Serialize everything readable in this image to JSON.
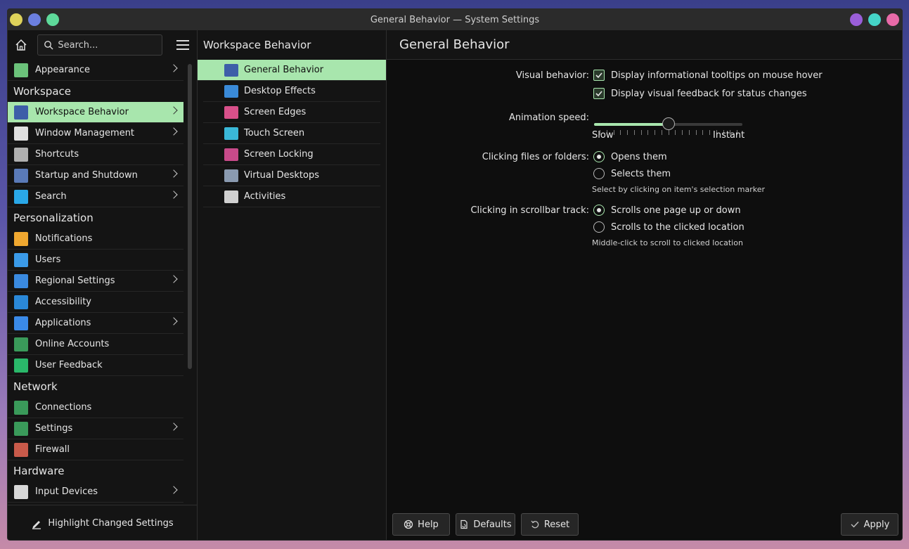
{
  "window": {
    "title": "General Behavior — System Settings"
  },
  "sidebar": {
    "search_placeholder": "Search...",
    "items": [
      {
        "type": "item",
        "label": "Appearance",
        "chevron": true,
        "icon": "appearance-icon",
        "color": "#6bc27a"
      },
      {
        "type": "header",
        "label": "Workspace"
      },
      {
        "type": "item",
        "label": "Workspace Behavior",
        "chevron": true,
        "active": true,
        "icon": "workspace-behavior-icon",
        "color": "#3d5ea8"
      },
      {
        "type": "item",
        "label": "Window Management",
        "chevron": true,
        "icon": "window-management-icon",
        "color": "#e0e0e0"
      },
      {
        "type": "item",
        "label": "Shortcuts",
        "chevron": false,
        "icon": "keyboard-icon",
        "color": "#b0b0b0"
      },
      {
        "type": "item",
        "label": "Startup and Shutdown",
        "chevron": true,
        "icon": "startup-icon",
        "color": "#5a7ab8"
      },
      {
        "type": "item",
        "label": "Search",
        "chevron": true,
        "icon": "search-settings-icon",
        "color": "#2aa8e8"
      },
      {
        "type": "header",
        "label": "Personalization"
      },
      {
        "type": "item",
        "label": "Notifications",
        "chevron": false,
        "icon": "bell-icon",
        "color": "#f0a830"
      },
      {
        "type": "item",
        "label": "Users",
        "chevron": false,
        "icon": "users-icon",
        "color": "#3a9ae8"
      },
      {
        "type": "item",
        "label": "Regional Settings",
        "chevron": true,
        "icon": "regional-icon",
        "color": "#3a8ae0"
      },
      {
        "type": "item",
        "label": "Accessibility",
        "chevron": false,
        "icon": "accessibility-icon",
        "color": "#2a88d8"
      },
      {
        "type": "item",
        "label": "Applications",
        "chevron": true,
        "icon": "applications-icon",
        "color": "#3a8ae8"
      },
      {
        "type": "item",
        "label": "Online Accounts",
        "chevron": false,
        "icon": "globe-icon",
        "color": "#3a9a5a"
      },
      {
        "type": "item",
        "label": "User Feedback",
        "chevron": false,
        "icon": "feedback-icon",
        "color": "#2ab86a"
      },
      {
        "type": "header",
        "label": "Network"
      },
      {
        "type": "item",
        "label": "Connections",
        "chevron": false,
        "icon": "globe-icon",
        "color": "#3a9a5a"
      },
      {
        "type": "item",
        "label": "Settings",
        "chevron": true,
        "icon": "globe-icon",
        "color": "#3a9a5a"
      },
      {
        "type": "item",
        "label": "Firewall",
        "chevron": false,
        "icon": "firewall-icon",
        "color": "#c85a4a"
      },
      {
        "type": "header",
        "label": "Hardware"
      },
      {
        "type": "item",
        "label": "Input Devices",
        "chevron": true,
        "icon": "mouse-icon",
        "color": "#d8d8d8"
      }
    ],
    "highlight_label": "Highlight Changed Settings"
  },
  "middle": {
    "title": "Workspace Behavior",
    "items": [
      {
        "label": "General Behavior",
        "active": true,
        "icon": "general-behavior-icon",
        "color": "#3d5ea8"
      },
      {
        "label": "Desktop Effects",
        "icon": "desktop-effects-icon",
        "color": "#3a8ad8"
      },
      {
        "label": "Screen Edges",
        "icon": "screen-edges-icon",
        "color": "#d8508a"
      },
      {
        "label": "Touch Screen",
        "icon": "touch-screen-icon",
        "color": "#3ab8d8"
      },
      {
        "label": "Screen Locking",
        "icon": "screen-locking-icon",
        "color": "#c84a8a"
      },
      {
        "label": "Virtual Desktops",
        "icon": "virtual-desktops-icon",
        "color": "#8a9ab0"
      },
      {
        "label": "Activities",
        "icon": "activities-icon",
        "color": "#d0d0d0"
      }
    ]
  },
  "main": {
    "title": "General Behavior",
    "visual_label": "Visual behavior:",
    "tooltips_label": "Display informational tooltips on mouse hover",
    "feedback_label": "Display visual feedback for status changes",
    "animation_label": "Animation speed:",
    "animation_value": 0.5,
    "slow_label": "Slow",
    "instant_label": "Instant",
    "clicking_label": "Clicking files or folders:",
    "opens_label": "Opens them",
    "selects_label": "Selects them",
    "select_hint": "Select by clicking on item's selection marker",
    "scrollbar_label": "Clicking in scrollbar track:",
    "scroll_page_label": "Scrolls one page up or down",
    "scroll_click_label": "Scrolls to the clicked location",
    "middle_hint": "Middle-click to scroll to clicked location"
  },
  "footer": {
    "help_label": "Help",
    "defaults_label": "Defaults",
    "reset_label": "Reset",
    "apply_label": "Apply"
  },
  "colors": {
    "accent": "#a8e6ad",
    "window_bg": "#141414",
    "titlebar": "#2b2b2b"
  }
}
